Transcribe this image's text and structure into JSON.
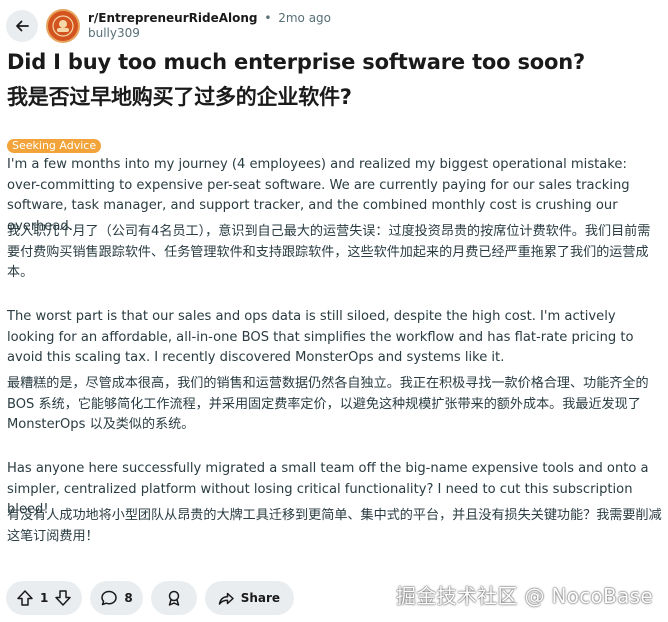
{
  "header": {
    "subreddit": "r/EntrepreneurRideAlong",
    "separator": "•",
    "time_ago": "2mo ago",
    "author": "bully309"
  },
  "post": {
    "title": "Did I buy too much enterprise software too soon?",
    "title_cn": "我是否过早地购买了过多的企业软件?",
    "flair": "Seeking Advice",
    "flair_color": "#f2a33a",
    "body": [
      "I'm a few months into my journey (4 employees) and realized my biggest operational mistake: over-committing to expensive per-seat software. We are currently paying for our sales tracking software, task manager, and support tracker, and the combined monthly cost is crushing our overhead.",
      "我入职几个月了（公司有4名员工），意识到自己最大的运营失误：过度投资昂贵的按席位计费软件。我们目前需要付费购买销售跟踪软件、任务管理软件和支持跟踪软件，这些软件加起来的月费已经严重拖累了我们的运营成本。",
      "The worst part is that our sales and ops data is still siloed, despite the high cost. I'm actively looking for an affordable, all-in-one BOS that simplifies the workflow and has flat-rate pricing to avoid this scaling tax. I recently discovered MonsterOps and systems like it.",
      "最糟糕的是，尽管成本很高，我们的销售和运营数据仍然各自独立。我正在积极寻找一款价格合理、功能齐全的 BOS 系统，它能够简化工作流程，并采用固定费率定价，以避免这种规模扩张带来的额外成本。我最近发现了 MonsterOps 以及类似的系统。",
      "Has anyone here successfully migrated a small team off the big-name expensive tools and onto a simpler, centralized platform without losing critical functionality? I need to cut this subscription bleed!",
      "有没有人成功地将小型团队从昂贵的大牌工具迁移到更简单、集中式的平台，并且没有损失关键功能？我需要削减这笔订阅费用！"
    ]
  },
  "actions": {
    "vote_count": "1",
    "comment_count": "8",
    "share_label": "Share"
  },
  "watermark": "掘金技术社区 @ NocoBase",
  "icons": {
    "back": "arrow-left-icon",
    "upvote": "arrow-up-icon",
    "downvote": "arrow-down-icon",
    "comment": "comment-bubble-icon",
    "award": "award-icon",
    "share": "share-arrow-icon"
  }
}
